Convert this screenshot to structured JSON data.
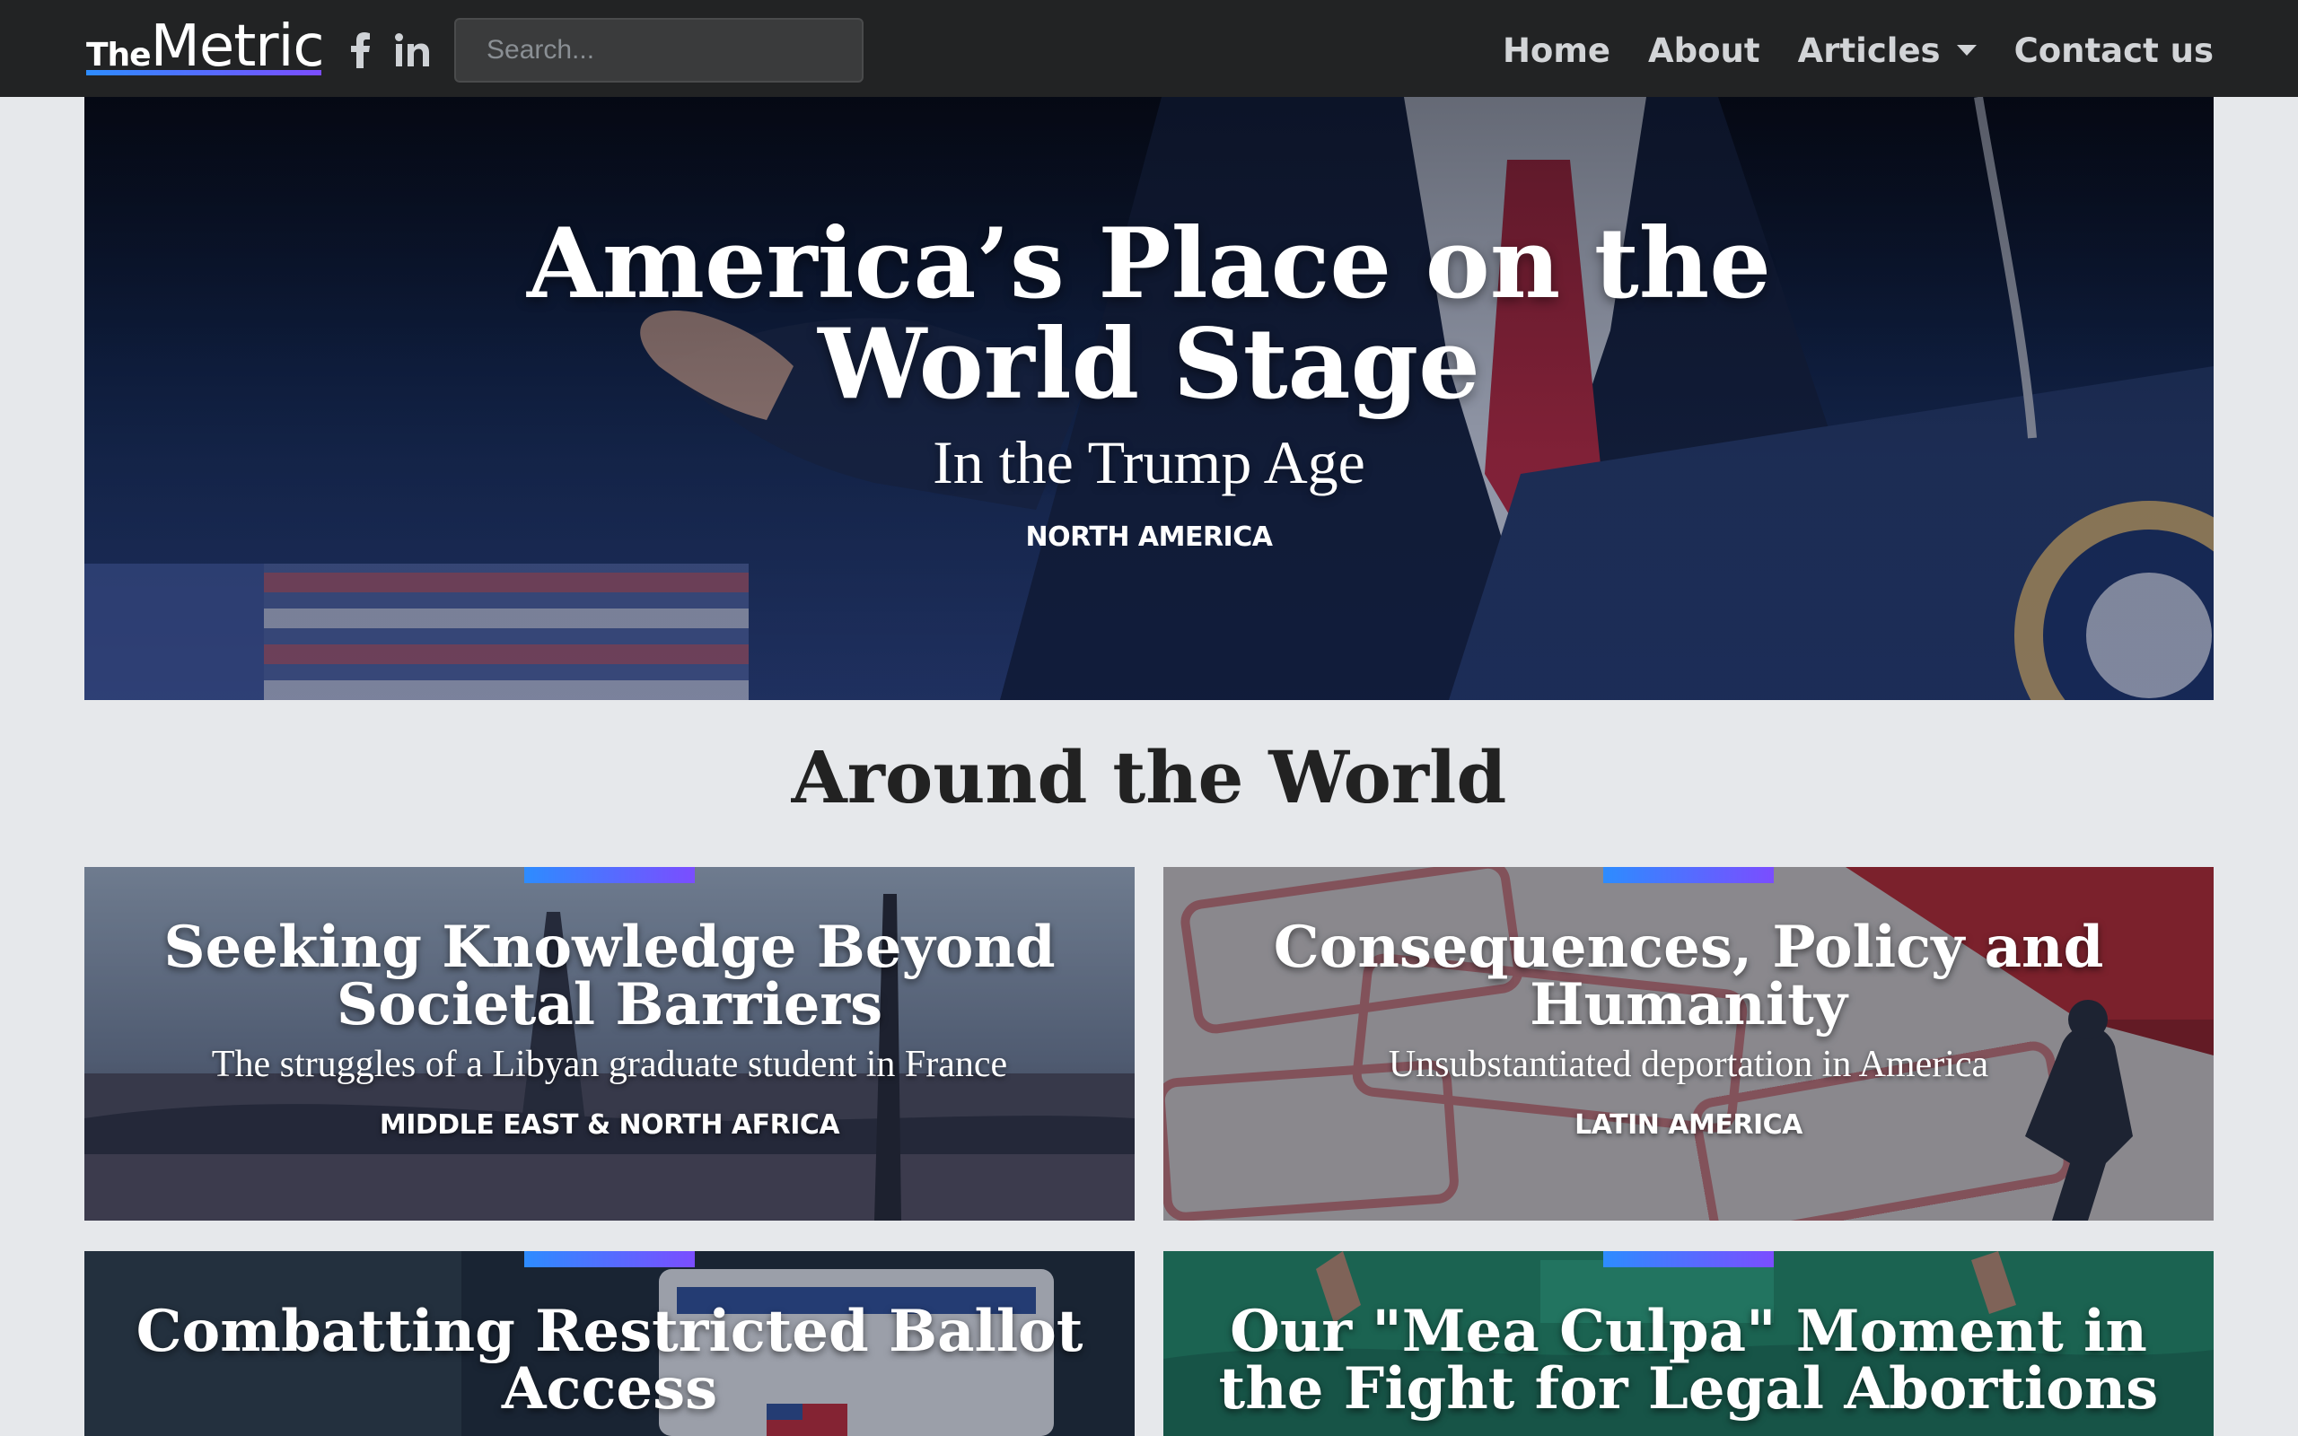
{
  "navbar": {
    "logo_the": "The",
    "logo_metric": "Metric",
    "social": [
      {
        "icon": "facebook-icon",
        "glyph": "f"
      },
      {
        "icon": "linkedin-icon",
        "glyph": "in"
      }
    ],
    "search_placeholder": "Search...",
    "links": [
      {
        "label": "Home"
      },
      {
        "label": "About"
      },
      {
        "label": "Articles",
        "icon": "chevron-down-icon"
      },
      {
        "label": "Contact us"
      }
    ]
  },
  "hero": {
    "title": "America’s Place on the World Stage",
    "subtitle": "In the Trump Age",
    "region": "NORTH AMERICA"
  },
  "section": {
    "title": "Around the World"
  },
  "articles": [
    {
      "title": "Seeking Knowledge Beyond Societal Barriers",
      "subtitle": "The struggles of a Libyan graduate student in France",
      "region": "MIDDLE EAST & NORTH AFRICA"
    },
    {
      "title": "Consequences, Policy and Humanity",
      "subtitle": "Unsubstantiated deportation in America",
      "region": "LATIN AMERICA"
    },
    {
      "title": "Combatting Restricted Ballot Access",
      "subtitle": "",
      "region": ""
    },
    {
      "title": "Our \"Mea Culpa\" Moment in the Fight for Legal Abortions",
      "subtitle": "",
      "region": ""
    }
  ],
  "colors": {
    "navbar_bg": "#222324",
    "page_bg": "#e6e8eb",
    "accent_start": "#2d8cff",
    "accent_end": "#7b4dff"
  }
}
